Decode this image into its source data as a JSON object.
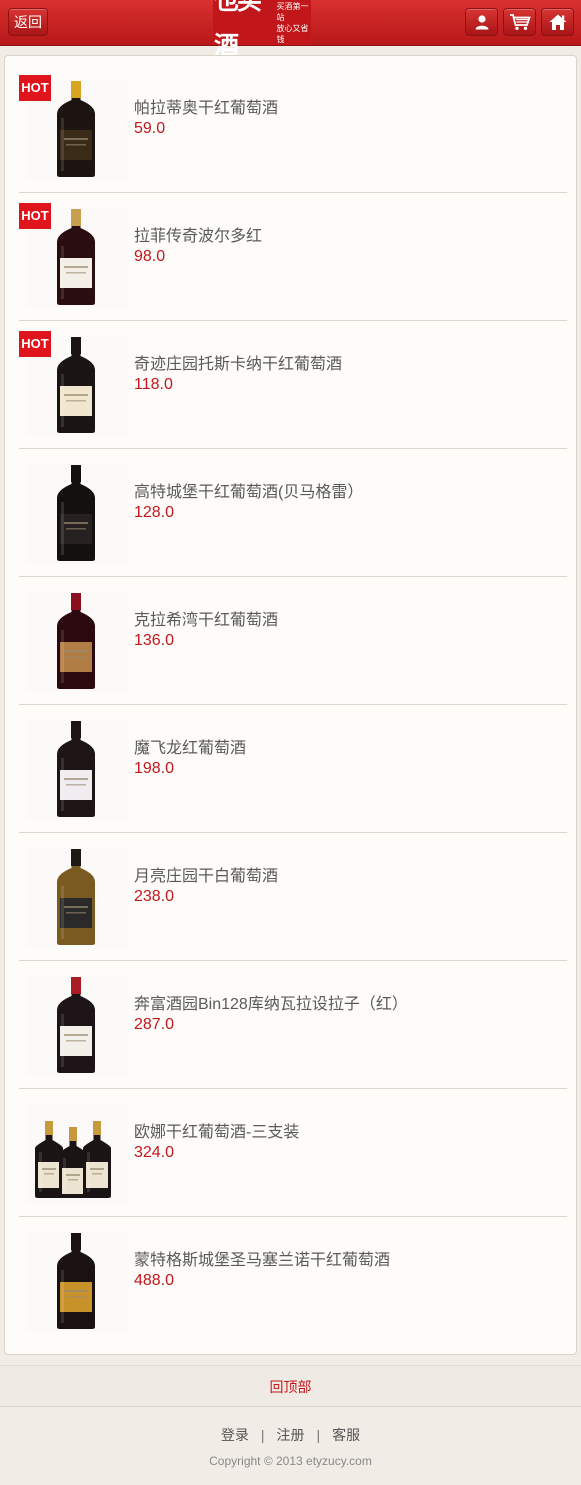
{
  "header": {
    "back_label": "返回",
    "logo_main": "也买酒",
    "logo_sub_line1": "买酒第一站",
    "logo_sub_line2": "放心又省钱",
    "user_icon": "user-icon",
    "cart_icon": "cart-icon",
    "home_icon": "home-icon",
    "accent_color": "#c4161c"
  },
  "hot_label": "HOT",
  "products": [
    {
      "name": "帕拉蒂奥干红葡萄酒",
      "price": "59.0",
      "hot": true,
      "bottle": "#1c1410",
      "capsule": "#d8a521",
      "label": "#3a2a18"
    },
    {
      "name": "拉菲传奇波尔多红",
      "price": "98.0",
      "hot": true,
      "bottle": "#2a0d10",
      "capsule": "#c8a050",
      "label": "#f3efe6"
    },
    {
      "name": "奇迹庄园托斯卡纳干红葡萄酒",
      "price": "118.0",
      "hot": true,
      "bottle": "#1a1512",
      "capsule": "#1a1512",
      "label": "#efe6cd"
    },
    {
      "name": "高特城堡干红葡萄酒(贝马格雷）",
      "price": "128.0",
      "hot": false,
      "bottle": "#151010",
      "capsule": "#151010",
      "label": "#262020"
    },
    {
      "name": "克拉希湾干红葡萄酒",
      "price": "136.0",
      "hot": false,
      "bottle": "#2a0a0e",
      "capsule": "#8a1020",
      "label": "#b07d44"
    },
    {
      "name": "魔飞龙红葡萄酒",
      "price": "198.0",
      "hot": false,
      "bottle": "#1d1416",
      "capsule": "#1d1416",
      "label": "#f0ecef"
    },
    {
      "name": "月亮庄园干白葡萄酒",
      "price": "238.0",
      "hot": false,
      "bottle": "#7a5a20",
      "capsule": "#1d1a16",
      "label": "#2a2a2a"
    },
    {
      "name": "奔富酒园Bin128库纳瓦拉设拉子（红）",
      "price": "287.0",
      "hot": false,
      "bottle": "#1c1416",
      "capsule": "#a81c26",
      "label": "#f3f0ea"
    },
    {
      "name": "欧娜干红葡萄酒-三支装",
      "price": "324.0",
      "hot": false,
      "bottle": "#1a1414",
      "capsule": "#c89a40",
      "label": "#ece4d0"
    },
    {
      "name": "蒙特格斯城堡圣马塞兰诺干红葡萄酒",
      "price": "488.0",
      "hot": false,
      "bottle": "#1a1212",
      "capsule": "#1a1212",
      "label": "#c8922a"
    }
  ],
  "back_to_top": "回顶部",
  "footer": {
    "login": "登录",
    "register": "注册",
    "service": "客服",
    "separator": "|",
    "copyright": "Copyright © 2013 etyzucy.com"
  }
}
